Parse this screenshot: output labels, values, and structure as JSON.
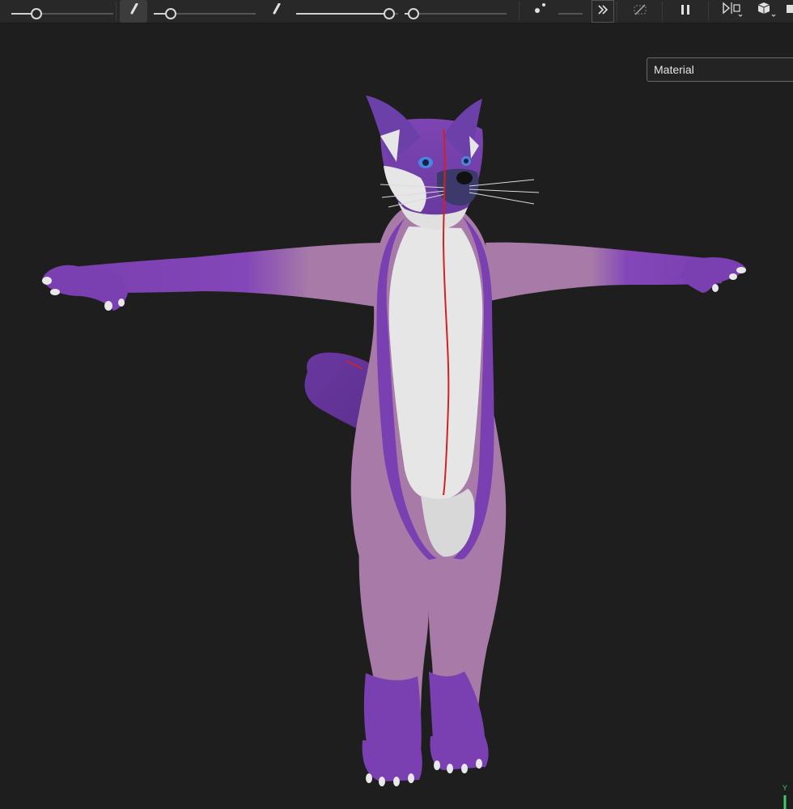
{
  "toolbar": {
    "slider_1": {
      "value": 0.3
    },
    "slider_2": {
      "value": 0.25
    },
    "slider_3": {
      "value": 0.9
    },
    "slider_4": {
      "value": 0.05
    },
    "icons": [
      "brush-icon",
      "brush-icon",
      "nodes-icon",
      "chevron-double-right-icon",
      "visibility-off-icon",
      "pause-icon",
      "mirror-icon",
      "cube-icon"
    ]
  },
  "viewport": {
    "material_dropdown": {
      "selected": "Material"
    },
    "axis_label": "Y"
  },
  "colors": {
    "toolbar_bg": "#282828",
    "viewport_bg": "#1e1e1e",
    "fur_purple": "#7a3fb0",
    "fur_pink": "#a77aa8",
    "fur_white": "#e6e6e6",
    "seam_red": "#d42020",
    "axis_green": "#3fc96b",
    "axis_blue": "#4a7fe0"
  }
}
